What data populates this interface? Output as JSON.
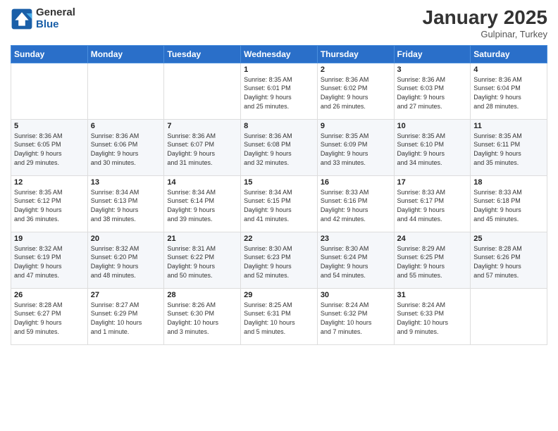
{
  "logo": {
    "general": "General",
    "blue": "Blue"
  },
  "header": {
    "month": "January 2025",
    "location": "Gulpinar, Turkey"
  },
  "weekdays": [
    "Sunday",
    "Monday",
    "Tuesday",
    "Wednesday",
    "Thursday",
    "Friday",
    "Saturday"
  ],
  "weeks": [
    [
      {
        "day": "",
        "info": ""
      },
      {
        "day": "",
        "info": ""
      },
      {
        "day": "",
        "info": ""
      },
      {
        "day": "1",
        "info": "Sunrise: 8:35 AM\nSunset: 6:01 PM\nDaylight: 9 hours\nand 25 minutes."
      },
      {
        "day": "2",
        "info": "Sunrise: 8:36 AM\nSunset: 6:02 PM\nDaylight: 9 hours\nand 26 minutes."
      },
      {
        "day": "3",
        "info": "Sunrise: 8:36 AM\nSunset: 6:03 PM\nDaylight: 9 hours\nand 27 minutes."
      },
      {
        "day": "4",
        "info": "Sunrise: 8:36 AM\nSunset: 6:04 PM\nDaylight: 9 hours\nand 28 minutes."
      }
    ],
    [
      {
        "day": "5",
        "info": "Sunrise: 8:36 AM\nSunset: 6:05 PM\nDaylight: 9 hours\nand 29 minutes."
      },
      {
        "day": "6",
        "info": "Sunrise: 8:36 AM\nSunset: 6:06 PM\nDaylight: 9 hours\nand 30 minutes."
      },
      {
        "day": "7",
        "info": "Sunrise: 8:36 AM\nSunset: 6:07 PM\nDaylight: 9 hours\nand 31 minutes."
      },
      {
        "day": "8",
        "info": "Sunrise: 8:36 AM\nSunset: 6:08 PM\nDaylight: 9 hours\nand 32 minutes."
      },
      {
        "day": "9",
        "info": "Sunrise: 8:35 AM\nSunset: 6:09 PM\nDaylight: 9 hours\nand 33 minutes."
      },
      {
        "day": "10",
        "info": "Sunrise: 8:35 AM\nSunset: 6:10 PM\nDaylight: 9 hours\nand 34 minutes."
      },
      {
        "day": "11",
        "info": "Sunrise: 8:35 AM\nSunset: 6:11 PM\nDaylight: 9 hours\nand 35 minutes."
      }
    ],
    [
      {
        "day": "12",
        "info": "Sunrise: 8:35 AM\nSunset: 6:12 PM\nDaylight: 9 hours\nand 36 minutes."
      },
      {
        "day": "13",
        "info": "Sunrise: 8:34 AM\nSunset: 6:13 PM\nDaylight: 9 hours\nand 38 minutes."
      },
      {
        "day": "14",
        "info": "Sunrise: 8:34 AM\nSunset: 6:14 PM\nDaylight: 9 hours\nand 39 minutes."
      },
      {
        "day": "15",
        "info": "Sunrise: 8:34 AM\nSunset: 6:15 PM\nDaylight: 9 hours\nand 41 minutes."
      },
      {
        "day": "16",
        "info": "Sunrise: 8:33 AM\nSunset: 6:16 PM\nDaylight: 9 hours\nand 42 minutes."
      },
      {
        "day": "17",
        "info": "Sunrise: 8:33 AM\nSunset: 6:17 PM\nDaylight: 9 hours\nand 44 minutes."
      },
      {
        "day": "18",
        "info": "Sunrise: 8:33 AM\nSunset: 6:18 PM\nDaylight: 9 hours\nand 45 minutes."
      }
    ],
    [
      {
        "day": "19",
        "info": "Sunrise: 8:32 AM\nSunset: 6:19 PM\nDaylight: 9 hours\nand 47 minutes."
      },
      {
        "day": "20",
        "info": "Sunrise: 8:32 AM\nSunset: 6:20 PM\nDaylight: 9 hours\nand 48 minutes."
      },
      {
        "day": "21",
        "info": "Sunrise: 8:31 AM\nSunset: 6:22 PM\nDaylight: 9 hours\nand 50 minutes."
      },
      {
        "day": "22",
        "info": "Sunrise: 8:30 AM\nSunset: 6:23 PM\nDaylight: 9 hours\nand 52 minutes."
      },
      {
        "day": "23",
        "info": "Sunrise: 8:30 AM\nSunset: 6:24 PM\nDaylight: 9 hours\nand 54 minutes."
      },
      {
        "day": "24",
        "info": "Sunrise: 8:29 AM\nSunset: 6:25 PM\nDaylight: 9 hours\nand 55 minutes."
      },
      {
        "day": "25",
        "info": "Sunrise: 8:28 AM\nSunset: 6:26 PM\nDaylight: 9 hours\nand 57 minutes."
      }
    ],
    [
      {
        "day": "26",
        "info": "Sunrise: 8:28 AM\nSunset: 6:27 PM\nDaylight: 9 hours\nand 59 minutes."
      },
      {
        "day": "27",
        "info": "Sunrise: 8:27 AM\nSunset: 6:29 PM\nDaylight: 10 hours\nand 1 minute."
      },
      {
        "day": "28",
        "info": "Sunrise: 8:26 AM\nSunset: 6:30 PM\nDaylight: 10 hours\nand 3 minutes."
      },
      {
        "day": "29",
        "info": "Sunrise: 8:25 AM\nSunset: 6:31 PM\nDaylight: 10 hours\nand 5 minutes."
      },
      {
        "day": "30",
        "info": "Sunrise: 8:24 AM\nSunset: 6:32 PM\nDaylight: 10 hours\nand 7 minutes."
      },
      {
        "day": "31",
        "info": "Sunrise: 8:24 AM\nSunset: 6:33 PM\nDaylight: 10 hours\nand 9 minutes."
      },
      {
        "day": "",
        "info": ""
      }
    ]
  ]
}
